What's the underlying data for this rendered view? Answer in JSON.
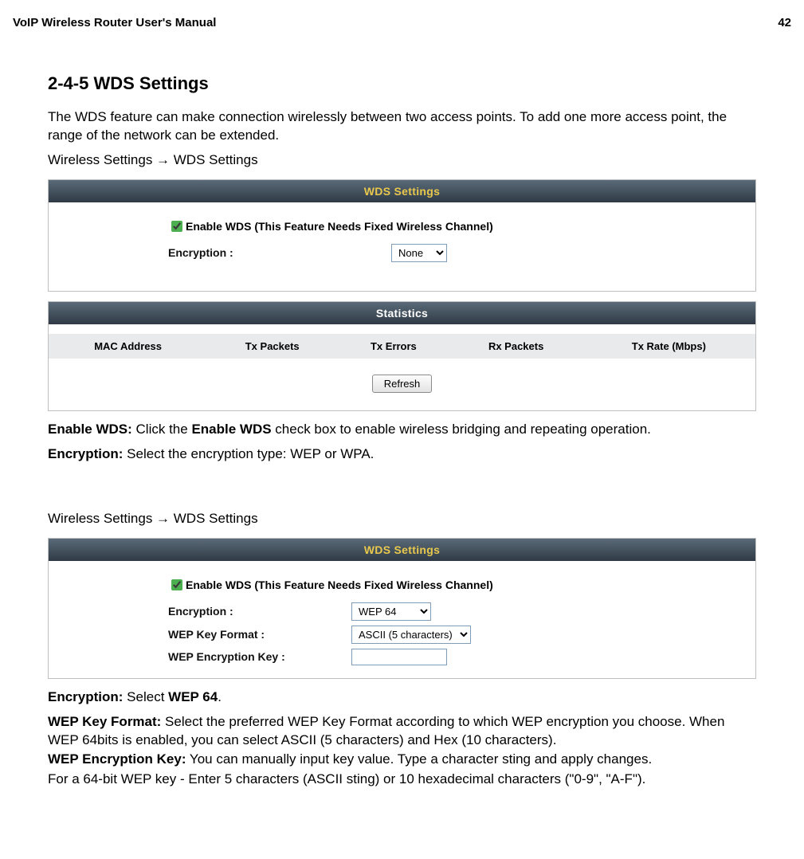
{
  "doc": {
    "header_left": "VoIP Wireless Router User's Manual",
    "header_right": "42",
    "section_title": "2-4-5 WDS Settings",
    "intro": "The WDS feature can make connection wirelessly between two access points. To add one more access point, the range of the network can be extended.",
    "breadcrumb_a": "Wireless Settings  →  WDS Settings",
    "enable_wds_label": "Enable WDS:",
    "enable_wds_text": " Click the ",
    "enable_wds_bold": "Enable WDS",
    "enable_wds_tail": " check box to enable wireless bridging and repeating operation.",
    "encryption_label": "Encryption:",
    "encryption_text": " Select the encryption type: WEP or WPA.",
    "breadcrumb_b": "Wireless Settings  →  WDS Settings",
    "enc64_label": "Encryption:",
    "enc64_text_a": " Select ",
    "enc64_bold": "WEP 64",
    "enc64_tail": ".",
    "wep_format_label": "WEP Key Format:",
    "wep_format_text": " Select the preferred WEP Key Format according to which WEP encryption you choose. When WEP 64bits is enabled, you can select ASCII (5 characters) and Hex (10 characters).",
    "wep_key_label": "WEP Encryption Key:",
    "wep_key_text": " You can manually input key value. Type a character sting and apply changes.",
    "wep_key_note": "For a 64-bit WEP key - Enter 5 characters (ASCII sting) or 10 hexadecimal characters (\"0-9\", \"A-F\")."
  },
  "panel1": {
    "title": "WDS Settings",
    "enable_label": "Enable WDS (This Feature Needs Fixed Wireless Channel)",
    "encryption_label": "Encryption :",
    "encryption_value": "None"
  },
  "stats": {
    "title": "Statistics",
    "columns": [
      "MAC Address",
      "Tx Packets",
      "Tx Errors",
      "Rx Packets",
      "Tx Rate (Mbps)"
    ],
    "refresh": "Refresh"
  },
  "panel2": {
    "title": "WDS Settings",
    "enable_label": "Enable WDS (This Feature Needs Fixed Wireless Channel)",
    "encryption_label": "Encryption :",
    "encryption_value": "WEP 64",
    "wep_format_label": "WEP Key Format :",
    "wep_format_value": "ASCII (5 characters)",
    "wep_key_label": "WEP Encryption Key :",
    "wep_key_value": ""
  }
}
